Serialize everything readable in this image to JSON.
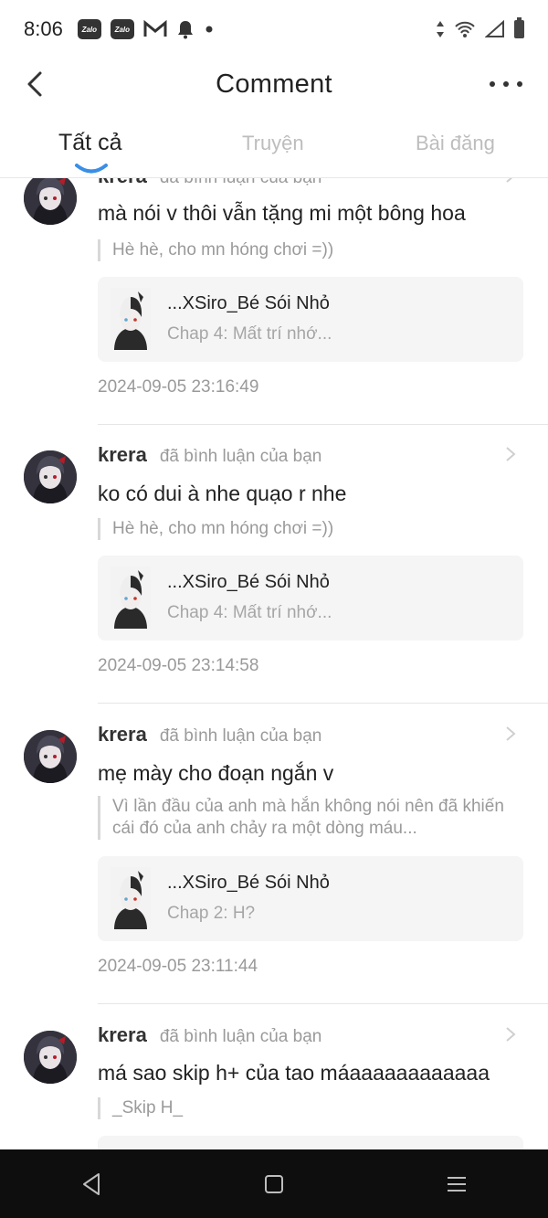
{
  "status_bar": {
    "time": "8:06",
    "left_icons": [
      "zalo-icon",
      "zalo-icon",
      "gmail-icon",
      "bell-icon",
      "dot-icon"
    ],
    "zalo_label": "Zalo",
    "right_icons": [
      "data-arrows-icon",
      "wifi-icon",
      "signal-icon",
      "battery-icon"
    ]
  },
  "header": {
    "title": "Comment",
    "back_icon": "chevron-left-icon",
    "more_icon": "more-dots-icon"
  },
  "tabs": [
    {
      "label": "Tất cả",
      "active": true
    },
    {
      "label": "Truyện",
      "active": false
    },
    {
      "label": "Bài đăng",
      "active": false
    }
  ],
  "comments": [
    {
      "user": "krera",
      "action": "đã bình luận của bạn",
      "text": "mà nói v thôi vẫn tặng mi một bông hoa",
      "quote": "Hè hè, cho mn hóng chơi =))",
      "card_title": "...XSiro_Bé Sói Nhỏ",
      "card_subtitle": "Chap 4: Mất trí nhớ...",
      "time": "2024-09-05 23:16:49"
    },
    {
      "user": "krera",
      "action": "đã bình luận của bạn",
      "text": "ko có dui à nhe quạo r nhe",
      "quote": "Hè hè, cho mn hóng chơi =))",
      "card_title": "...XSiro_Bé Sói Nhỏ",
      "card_subtitle": "Chap 4: Mất trí nhớ...",
      "time": "2024-09-05 23:14:58"
    },
    {
      "user": "krera",
      "action": "đã bình luận của bạn",
      "text": "mẹ mày cho đoạn ngắn v",
      "quote": "Vì lần đầu của anh mà hắn không nói nên đã khiến cái đó của anh chảy ra một dòng máu...",
      "card_title": "...XSiro_Bé Sói Nhỏ",
      "card_subtitle": "Chap 2: H?",
      "time": "2024-09-05 23:11:44"
    },
    {
      "user": "krera",
      "action": "đã bình luận của bạn",
      "text": "má sao skip h+ của tao máaaaaaaaaaaaa",
      "quote": "_Skip H_"
    }
  ],
  "navbar": {
    "icons": [
      "back-triangle-icon",
      "home-square-icon",
      "menu-lines-icon"
    ]
  },
  "colors": {
    "accent": "#3a8ee6",
    "muted": "#9a9a9a",
    "card_bg": "#f5f5f5",
    "navbar_bg": "#0e0e0e"
  }
}
